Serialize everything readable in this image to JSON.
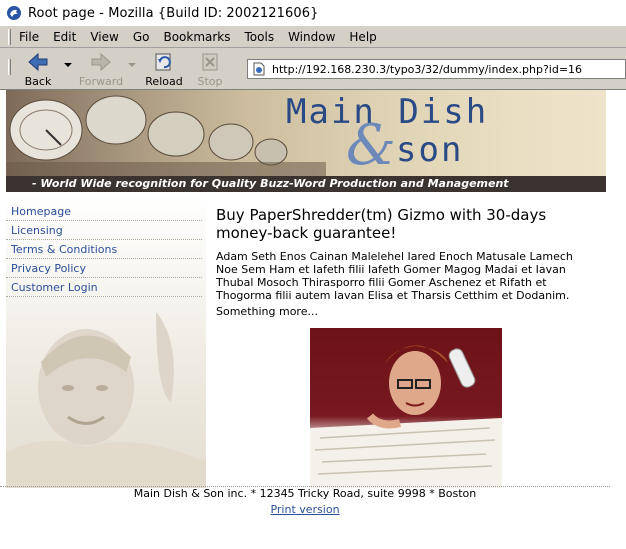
{
  "window": {
    "title": "Root page - Mozilla {Build ID: 2002121606}"
  },
  "menu": {
    "items": [
      "File",
      "Edit",
      "View",
      "Go",
      "Bookmarks",
      "Tools",
      "Window",
      "Help"
    ]
  },
  "toolbar": {
    "back": "Back",
    "forward": "Forward",
    "reload": "Reload",
    "stop": "Stop"
  },
  "address": {
    "url": "http://192.168.230.3/typo3/32/dummy/index.php?id=16"
  },
  "site": {
    "logo_line1": "Main Dish",
    "logo_amp": "&",
    "logo_line2": "son",
    "tagline": "- World Wide recognition for Quality Buzz-Word Production and Management"
  },
  "nav": {
    "items": [
      "Homepage",
      "Licensing",
      "Terms & Conditions",
      "Privacy Policy",
      "Customer Login"
    ]
  },
  "article": {
    "headline": "Buy PaperShredder(tm) Gizmo with 30-days money-back guarantee!",
    "body": "Adam Seth Enos Cainan Malelehel Iared Enoch Matusale Lamech Noe Sem Ham et Iafeth filii Iafeth Gomer Magog Madai et Iavan Thubal Mosoch Thirasporro filii Gomer Aschenez et Rifath et Thogorma filii autem Iavan Elisa et Tharsis Cetthim et Dodanim.",
    "more": "Something more..."
  },
  "footer": {
    "address": "Main Dish & Son inc. * 12345 Tricky Road, suite 9998 * Boston",
    "print": "Print version"
  }
}
